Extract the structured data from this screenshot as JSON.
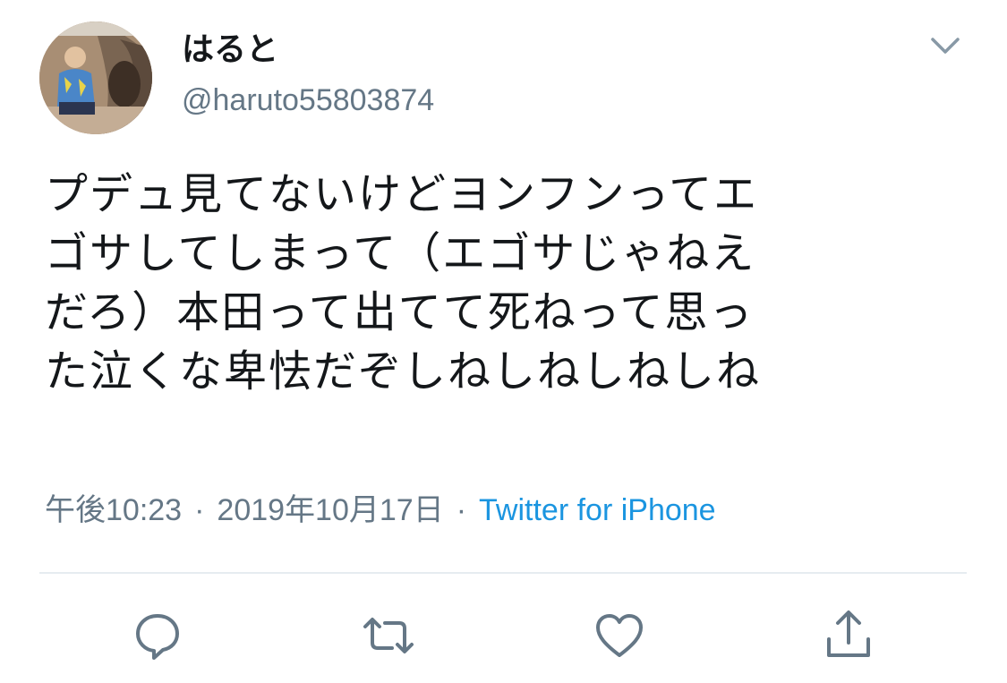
{
  "user": {
    "display_name": "はると",
    "handle": "@haruto55803874",
    "avatar_icon": "avatar-photo"
  },
  "tweet": {
    "lines": [
      "プデュ見てないけどヨンフンってエ",
      "ゴサしてしまって（エゴサじゃねえ",
      "だろ）本田って出てて死ねって思っ",
      "た泣くな卑怯だぞしねしねしねしね"
    ]
  },
  "meta": {
    "time": "午後10:23",
    "separator": "·",
    "date": "2019年10月17日",
    "source": "Twitter for iPhone"
  },
  "actions": {
    "icons": [
      "reply-icon",
      "retweet-icon",
      "like-icon",
      "share-icon"
    ]
  },
  "colors": {
    "text": "#14171a",
    "secondary": "#657786",
    "link": "#1b95e0",
    "divider": "#e6ecf0"
  }
}
